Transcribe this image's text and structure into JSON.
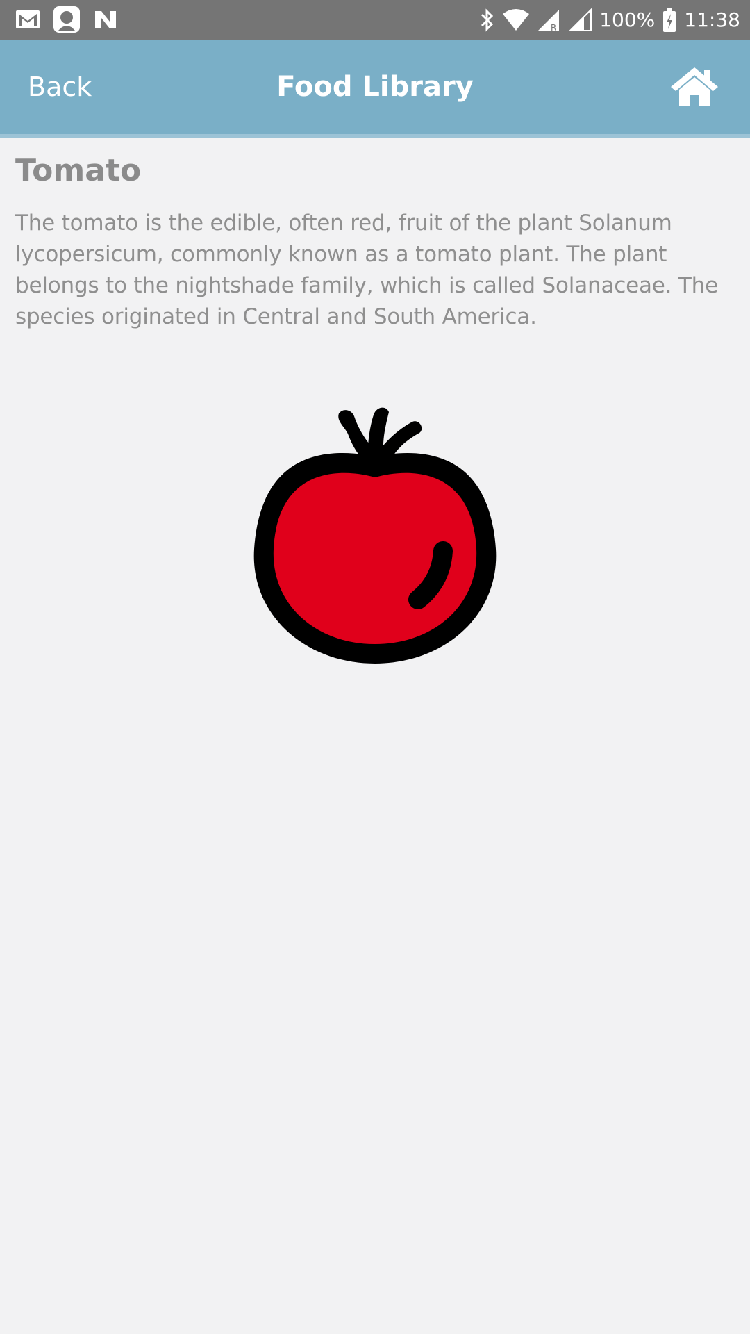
{
  "status_bar": {
    "battery": "100%",
    "time": "11:38",
    "left_icons": [
      "gmail-icon",
      "app-avatar-icon",
      "n-icon"
    ],
    "right_icons": [
      "bluetooth-icon",
      "wifi-icon",
      "signal-roaming-icon",
      "signal-icon",
      "battery-charging-icon"
    ]
  },
  "header": {
    "back_label": "Back",
    "title": "Food Library",
    "home_icon": "home-icon"
  },
  "food": {
    "name": "Tomato",
    "description": "The tomato is the edible, often red, fruit of the plant Solanum lycopersicum, commonly known as a tomato plant. The plant belongs to the nightshade family, which is called Solanaceae. The species originated in Central and South America.",
    "image_icon": "tomato-icon"
  },
  "colors": {
    "header_bg": "#7aafc7",
    "status_bg": "#757575",
    "page_bg": "#f2f2f3",
    "tomato_red": "#e0001b"
  }
}
